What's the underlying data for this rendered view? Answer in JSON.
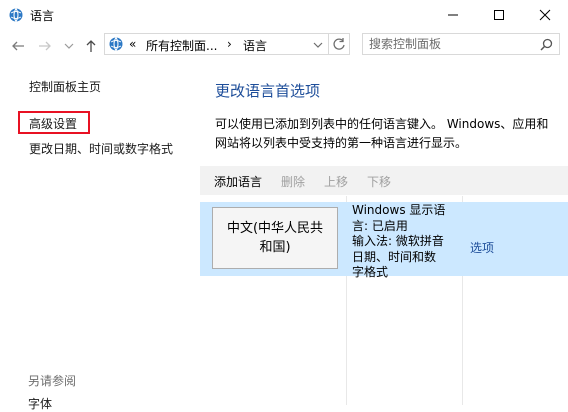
{
  "window": {
    "title": "语言"
  },
  "address": {
    "breadcrumb_sep": "«",
    "crumb1": "所有控制面...",
    "arrow": "›",
    "crumb2": "语言",
    "search_placeholder": "搜索控制面板"
  },
  "sidebar": {
    "home": "控制面板主页",
    "advanced": "高级设置",
    "datetime": "更改日期、时间或数字格式",
    "see_also": "另请参阅",
    "fonts": "字体"
  },
  "main": {
    "heading": "更改语言首选项",
    "description": "可以使用已添加到列表中的任何语言键入。 Windows、应用和网站将以列表中受支持的第一种语言进行显示。",
    "toolbar": {
      "add": "添加语言",
      "remove": "删除",
      "up": "上移",
      "down": "下移"
    },
    "languages": [
      {
        "name_line1": "中文(中华人民共",
        "name_line2": "和国)",
        "info1": "Windows 显示语",
        "info2": "言: 已启用",
        "info3": "输入法: 微软拼音",
        "info4": "日期、时间和数",
        "info5": "字格式",
        "options": "选项"
      }
    ]
  },
  "colors": {
    "accent": "#1e4e9a",
    "selected_row": "#cce8ff",
    "highlight_border": "#e81123"
  }
}
